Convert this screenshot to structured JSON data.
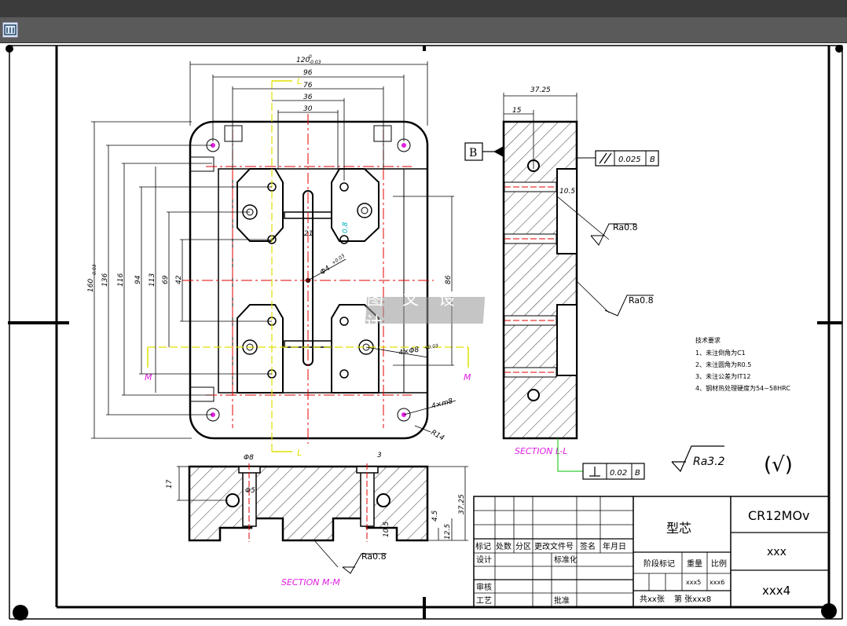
{
  "toolbar": {
    "icon": "tool-icon"
  },
  "watermark": {
    "text": "图 文 设 计"
  },
  "dims": {
    "w120": "120",
    "w120_tol_up": "0",
    "w120_tol_dn": "-0.03",
    "w96": "96",
    "w76": "76",
    "w36": "36",
    "w30": "30",
    "h160": "160",
    "h160_tol": "-0.03",
    "h136": "136",
    "h116": "116",
    "h94": "94",
    "h113": "113",
    "h69": "69",
    "h42": "42",
    "h86": "86",
    "w21": "21",
    "phi4": "Φ4",
    "phi4_tol": "+0.03",
    "phi8": "4×Φ8",
    "phi8_tol": "+0.03",
    "m8": "4×m8",
    "r14": "R14",
    "r08": "0.8",
    "side_w": "37.25",
    "side_15": "15",
    "side_105": "10.5",
    "bot_phi8": "Φ8",
    "bot_phi5": "Φ5",
    "bot_3": "3",
    "bot_17": "17",
    "bot_3725": "37.25",
    "bot_125": "12.5",
    "bot_45": "4.5",
    "bot_105": "10.5"
  },
  "labels": {
    "datum_b": "B",
    "parallel_val": "0.025",
    "parallel_ref": "B",
    "perp_val": "0.02",
    "perp_ref": "B",
    "ra1": "Ra0.8",
    "ra2": "Ra0.8",
    "ra3": "Ra0.8",
    "ra_main": "Ra3.2",
    "ra_paren": "(√)",
    "sec_ll": "SECTION L-L",
    "sec_mm": "SECTION M-M",
    "L_top": "L",
    "L_bot": "L",
    "M_left": "M",
    "M_right": "M"
  },
  "tech": {
    "title": "技术要求",
    "items": [
      "1、未注倒角为C1",
      "2、未注圆角为R0.5",
      "3、未注公差为IT12",
      "4、钢材热处理硬度为54~58HRC"
    ]
  },
  "title_block": {
    "part_name": "型芯",
    "material": "CR12MOv",
    "org": "xxx",
    "drawing_no": "xxx4",
    "h_mark": "标记",
    "h_count": "处数",
    "h_zone": "分区",
    "h_docno": "更改文件号",
    "h_sign": "签名",
    "h_date": "年月日",
    "r_design": "设计",
    "r_std": "标准化",
    "r_review": "审核",
    "r_process": "工艺",
    "r_approve": "批准",
    "stage": "阶段标记",
    "weight": "重量",
    "scale": "比例",
    "weight_val": "xxx5",
    "scale_val": "xxx6",
    "sheets": "共xx张",
    "sheet_no": "第 张xxx8"
  }
}
